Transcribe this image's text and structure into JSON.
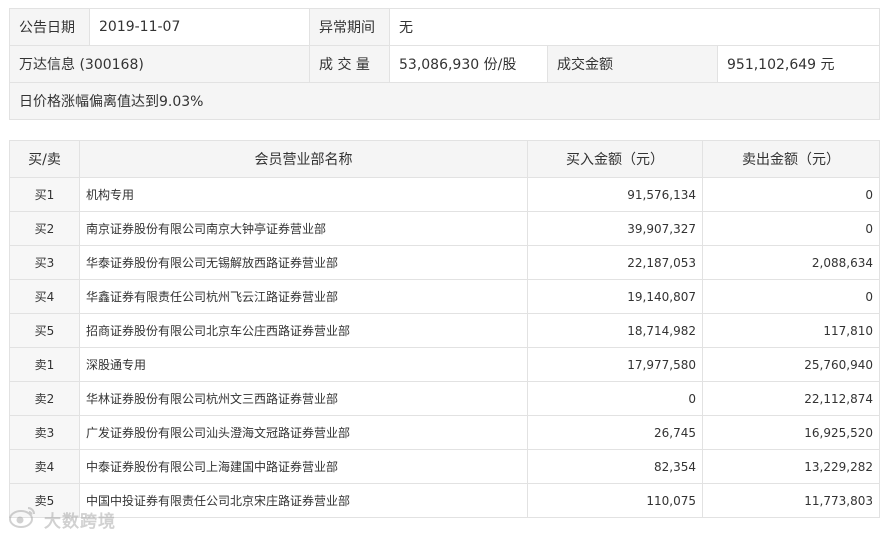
{
  "info": {
    "announce_date_label": "公告日期",
    "announce_date": "2019-11-07",
    "abnormal_period_label": "异常期间",
    "abnormal_period": "无",
    "stock_name": "万达信息 (300168)",
    "volume_label": "成 交 量",
    "volume": "53,086,930 份/股",
    "amount_label": "成交金额",
    "amount": "951,102,649 元",
    "reason": "日价格涨幅偏离值达到9.03%"
  },
  "table": {
    "headers": {
      "side": "买/卖",
      "name": "会员营业部名称",
      "buy": "买入金额（元）",
      "sell": "卖出金额（元）"
    },
    "rows": [
      {
        "side": "买1",
        "name": "机构专用",
        "buy": "91,576,134",
        "sell": "0"
      },
      {
        "side": "买2",
        "name": "南京证券股份有限公司南京大钟亭证券营业部",
        "buy": "39,907,327",
        "sell": "0"
      },
      {
        "side": "买3",
        "name": "华泰证券股份有限公司无锡解放西路证券营业部",
        "buy": "22,187,053",
        "sell": "2,088,634"
      },
      {
        "side": "买4",
        "name": "华鑫证券有限责任公司杭州飞云江路证券营业部",
        "buy": "19,140,807",
        "sell": "0"
      },
      {
        "side": "买5",
        "name": "招商证券股份有限公司北京车公庄西路证券营业部",
        "buy": "18,714,982",
        "sell": "117,810"
      },
      {
        "side": "卖1",
        "name": "深股通专用",
        "buy": "17,977,580",
        "sell": "25,760,940"
      },
      {
        "side": "卖2",
        "name": "华林证券股份有限公司杭州文三西路证券营业部",
        "buy": "0",
        "sell": "22,112,874"
      },
      {
        "side": "卖3",
        "name": "广发证券股份有限公司汕头澄海文冠路证券营业部",
        "buy": "26,745",
        "sell": "16,925,520"
      },
      {
        "side": "卖4",
        "name": "中泰证券股份有限公司上海建国中路证券营业部",
        "buy": "82,354",
        "sell": "13,229,282"
      },
      {
        "side": "卖5",
        "name": "中国中投证券有限责任公司北京宋庄路证券营业部",
        "buy": "110,075",
        "sell": "11,773,803"
      }
    ]
  },
  "watermark": {
    "icon": "sina-eye-logo-icon",
    "text": "大数跨境"
  }
}
